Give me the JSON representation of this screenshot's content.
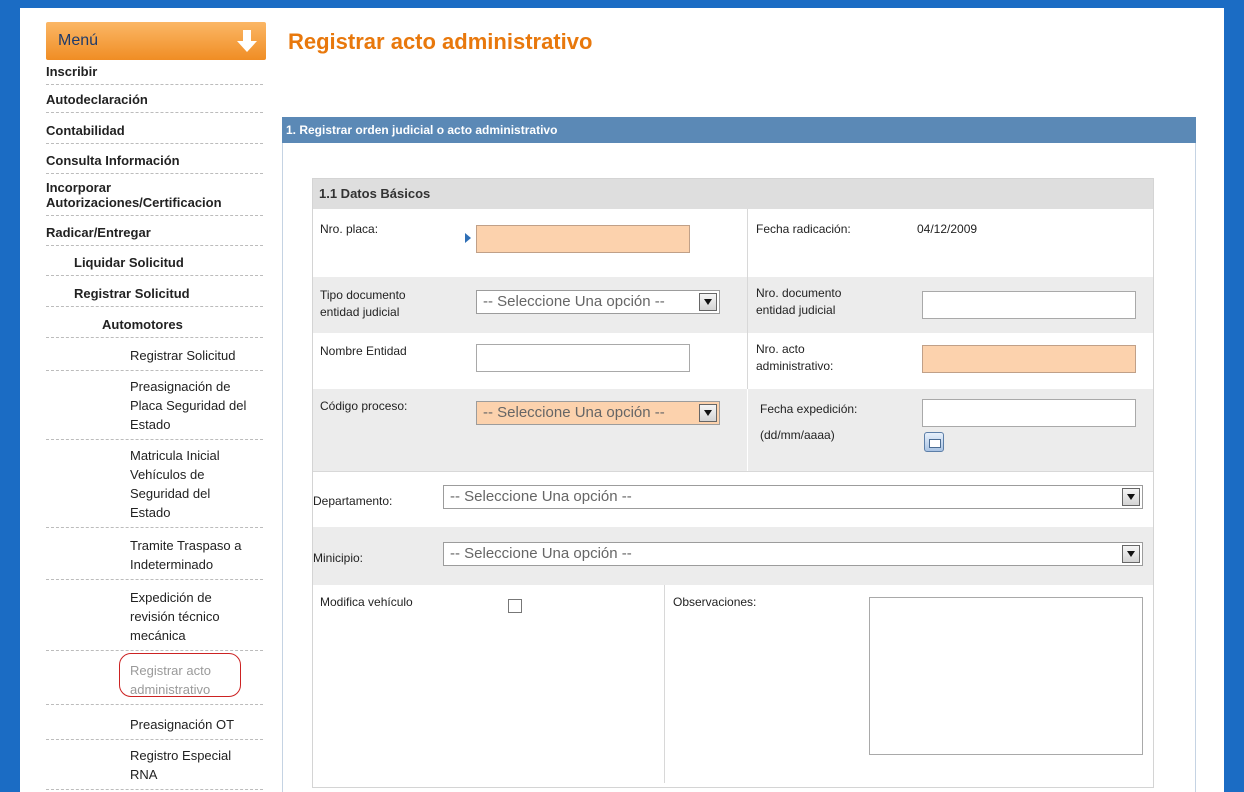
{
  "menu": {
    "title": "Menú",
    "items": [
      {
        "label": "Inscribir"
      },
      {
        "label": "Autodeclaración"
      },
      {
        "label": "Contabilidad"
      },
      {
        "label": "Consulta Información"
      },
      {
        "label": "Incorporar Autorizaciones/Certificacion"
      },
      {
        "label": "Radicar/Entregar"
      },
      {
        "label": "Liquidar Solicitud"
      },
      {
        "label": "Registrar Solicitud"
      },
      {
        "label": "Automotores"
      },
      {
        "label": "Registrar Solicitud"
      },
      {
        "label": "Preasignación de Placa Seguridad del Estado"
      },
      {
        "label": "Matricula Inicial Vehículos de Seguridad del Estado"
      },
      {
        "label": "Tramite Traspaso a Indeterminado"
      },
      {
        "label": "Expedición de revisión técnico mecánica"
      },
      {
        "label": "Registrar acto administrativo"
      },
      {
        "label": "Preasignación OT"
      },
      {
        "label": "Registro Especial RNA"
      }
    ]
  },
  "page": {
    "title": "Registrar acto administrativo",
    "section_title": "1. Registrar orden judicial o acto administrativo",
    "panel_title": "1.1 Datos Básicos"
  },
  "form": {
    "nro_placa_label": "Nro. placa:",
    "fecha_radicacion_label": "Fecha radicación:",
    "fecha_radicacion_value": "04/12/2009",
    "tipo_documento_label": "Tipo documento entidad judicial",
    "tipo_documento_value": "-- Seleccione Una opción --",
    "nro_documento_label": "Nro. documento entidad judicial",
    "nombre_entidad_label": "Nombre Entidad",
    "nro_acto_label": "Nro. acto administrativo:",
    "codigo_proceso_label": "Código proceso:",
    "codigo_proceso_value": "-- Seleccione Una opción --",
    "fecha_expedicion_label": "Fecha expedición:",
    "fecha_expedicion_format": "(dd/mm/aaaa)",
    "departamento_label": "Departamento:",
    "departamento_value": "-- Seleccione Una opción --",
    "municipio_label": "Minicipio:",
    "municipio_value": "-- Seleccione Una opción --",
    "modifica_vehiculo_label": "Modifica vehículo",
    "observaciones_label": "Observaciones:"
  },
  "colors": {
    "accent": "#e8780c",
    "section_bar": "#5b89b6",
    "required_field": "#fcd2ad",
    "frame": "#1b6cc4"
  }
}
